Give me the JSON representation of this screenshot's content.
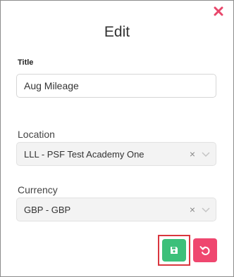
{
  "dialog": {
    "title": "Edit",
    "close_icon": "close-icon"
  },
  "form": {
    "title_label": "Title",
    "title_value": "Aug Mileage",
    "location_label": "Location",
    "location_value": "LLL - PSF Test Academy One",
    "currency_label": "Currency",
    "currency_value": "GBP - GBP",
    "clear_glyph": "×"
  },
  "actions": {
    "save_icon": "save-icon",
    "reset_icon": "undo-icon"
  },
  "colors": {
    "close": "#e8466a",
    "save": "#3cc07a",
    "reset": "#ef476f",
    "highlight": "#d9363e"
  }
}
